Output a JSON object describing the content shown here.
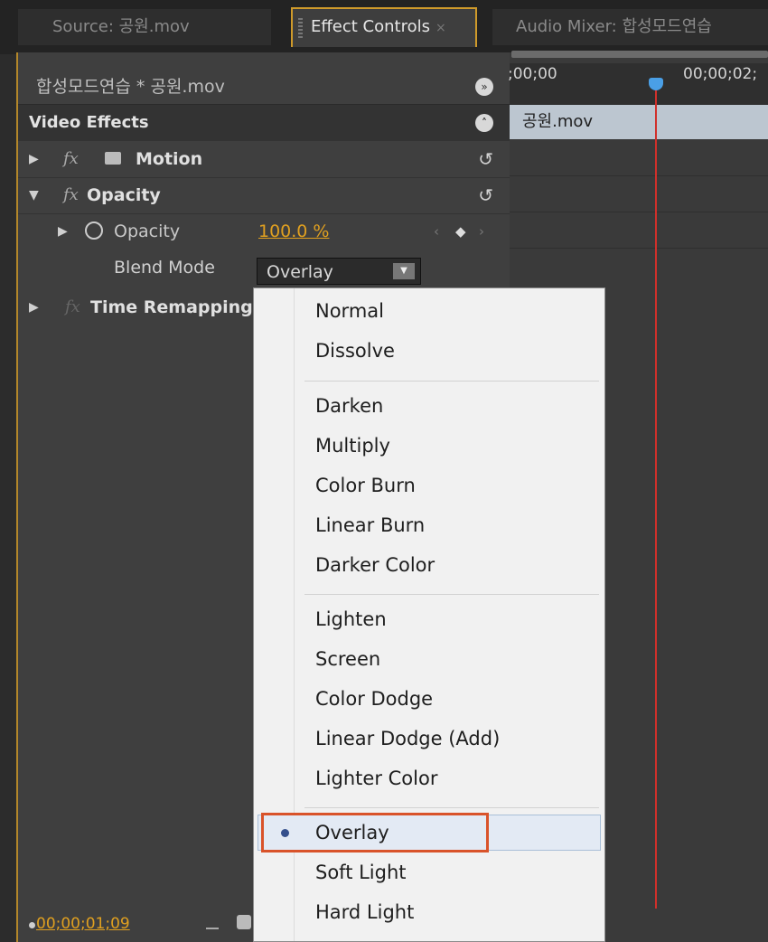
{
  "tabs": {
    "source": "Source: 공원.mov",
    "effect_controls": "Effect Controls",
    "audio_mixer": "Audio Mixer: 합성모드연습"
  },
  "effects_panel": {
    "clip_title": "합성모드연습 * 공원.mov",
    "section_title": "Video Effects",
    "motion_label": "Motion",
    "opacity_label": "Opacity",
    "opacity_property_label": "Opacity",
    "opacity_value": "100.0 %",
    "blend_mode_label": "Blend Mode",
    "blend_mode_value": "Overlay",
    "time_remapping_label": "Time Remapping",
    "fx_glyph": "fx"
  },
  "timeline": {
    "time_start": ";00;00",
    "time_mark": "00;00;02;",
    "clip_label": "공원.mov"
  },
  "timecode": "00;00;01;09",
  "blend_menu": {
    "groups": [
      [
        "Normal",
        "Dissolve"
      ],
      [
        "Darken",
        "Multiply",
        "Color Burn",
        "Linear Burn",
        "Darker Color"
      ],
      [
        "Lighten",
        "Screen",
        "Color Dodge",
        "Linear Dodge (Add)",
        "Lighter Color"
      ],
      [
        "Overlay",
        "Soft Light",
        "Hard Light"
      ]
    ],
    "selected": "Overlay"
  },
  "colors": {
    "accent": "#cf9a2a",
    "timecode": "#e0a020",
    "playhead": "#d0302b",
    "highlight_box": "#d9532a"
  }
}
